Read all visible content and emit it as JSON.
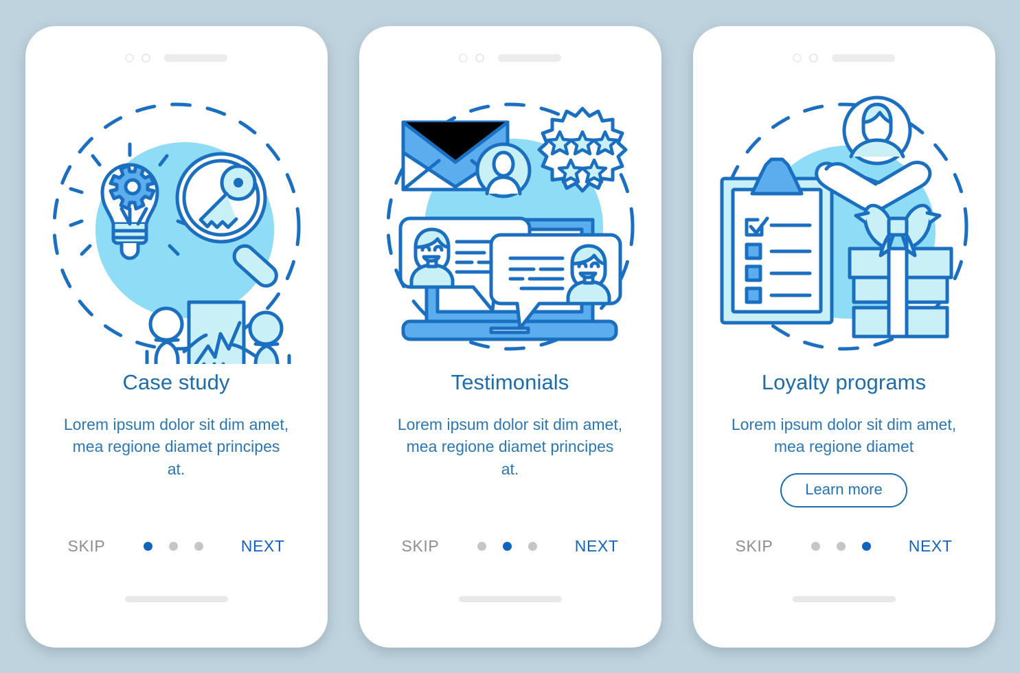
{
  "background_color": "#bfd3de",
  "theme": {
    "title_color": "#1e6cab",
    "text_color": "#2b77b4",
    "accent_blue": "#1163c0",
    "outline_blue": "#1b6fc0",
    "mid_blue": "#5cadee",
    "pale_blue": "#8fdcf6",
    "light_cyan": "#c9f0f7",
    "skip_gray": "#8e8e8e",
    "dot_inactive": "#c6c6c6"
  },
  "screens": [
    {
      "id": "case-study",
      "title": "Case study",
      "description": "Lorem ipsum dolor sit dim amet, mea regione diamet principes at.",
      "has_learn_more": false,
      "learn_more_label": "",
      "skip_label": "SKIP",
      "next_label": "NEXT",
      "dots": [
        true,
        false,
        false
      ],
      "illustration": "lightbulb-gear-magnifier-key-presentation"
    },
    {
      "id": "testimonials",
      "title": "Testimonials",
      "description": "Lorem ipsum dolor sit dim amet, mea regione diamet principes at.",
      "has_learn_more": false,
      "learn_more_label": "",
      "skip_label": "SKIP",
      "next_label": "NEXT",
      "dots": [
        false,
        true,
        false
      ],
      "illustration": "envelope-avatar-stars-laptop-chat"
    },
    {
      "id": "loyalty-programs",
      "title": "Loyalty programs",
      "description": "Lorem ipsum dolor sit dim amet, mea regione diamet",
      "has_learn_more": true,
      "learn_more_label": "Learn more",
      "skip_label": "SKIP",
      "next_label": "NEXT",
      "dots": [
        false,
        false,
        true
      ],
      "illustration": "clipboard-checklist-avatar-hands-gift"
    }
  ]
}
